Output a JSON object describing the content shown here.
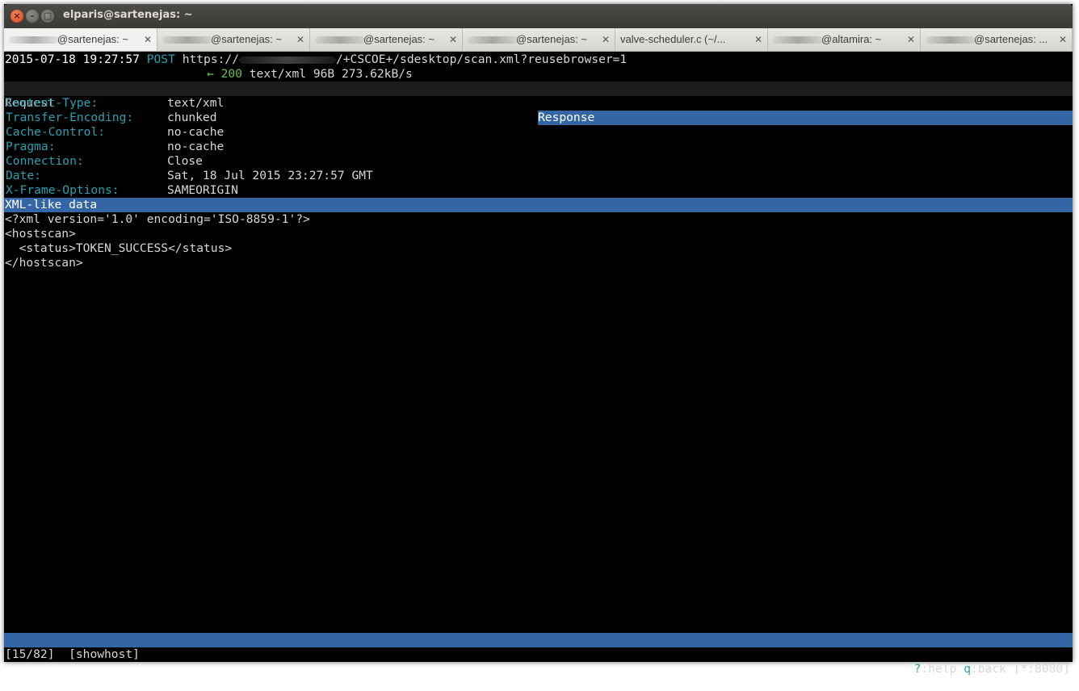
{
  "window": {
    "title": "elparis@sartenejas: ~"
  },
  "tabs": [
    {
      "label": "@sartenejas: ~",
      "redacted_prefix": true,
      "active": true
    },
    {
      "label": "@sartenejas: ~",
      "redacted_prefix": true
    },
    {
      "label": "@sartenejas: ~",
      "redacted_prefix": true
    },
    {
      "label": "@sartenejas: ~",
      "redacted_prefix": true
    },
    {
      "label": "valve-scheduler.c (~/...",
      "redacted_prefix": false
    },
    {
      "label": "@altamira: ~",
      "redacted_prefix": true
    },
    {
      "label": "@sartenejas: ...",
      "redacted_prefix": true
    }
  ],
  "flow": {
    "timestamp": "2015-07-18 19:27:57",
    "method": "POST",
    "url_prefix": "https://",
    "url_suffix": "/+CSCOE+/sdesktop/scan.xml?reusebrowser=1",
    "arrow": "←",
    "status_code": "200",
    "response_info": "text/xml 96B 273.62kB/s"
  },
  "tabs_panel": {
    "request": "Request",
    "response": "Response"
  },
  "headers": [
    {
      "key": "Content-Type:",
      "value": "text/xml"
    },
    {
      "key": "Transfer-Encoding:",
      "value": "chunked"
    },
    {
      "key": "Cache-Control:",
      "value": "no-cache"
    },
    {
      "key": "Pragma:",
      "value": "no-cache"
    },
    {
      "key": "Connection:",
      "value": "Close"
    },
    {
      "key": "Date:",
      "value": "Sat, 18 Jul 2015 23:27:57 GMT"
    },
    {
      "key": "X-Frame-Options:",
      "value": "SAMEORIGIN"
    }
  ],
  "body_view": {
    "label": "XML-like data",
    "lines": [
      "<?xml version='1.0' encoding='ISO-8859-1'?>",
      "<hostscan>",
      "  <status>TOKEN_SUCCESS</status>",
      "</hostscan>"
    ]
  },
  "status": {
    "position": "[15/82]",
    "flags": "[showhost]",
    "help_key": "?",
    "help_label": ":help ",
    "back_key": "q",
    "back_label": ":back ",
    "listen": "[*:8080]"
  },
  "colors": {
    "accent_blue": "#3465a4",
    "key_cyan": "#2aa1b3",
    "status_green": "#6cc04a"
  }
}
